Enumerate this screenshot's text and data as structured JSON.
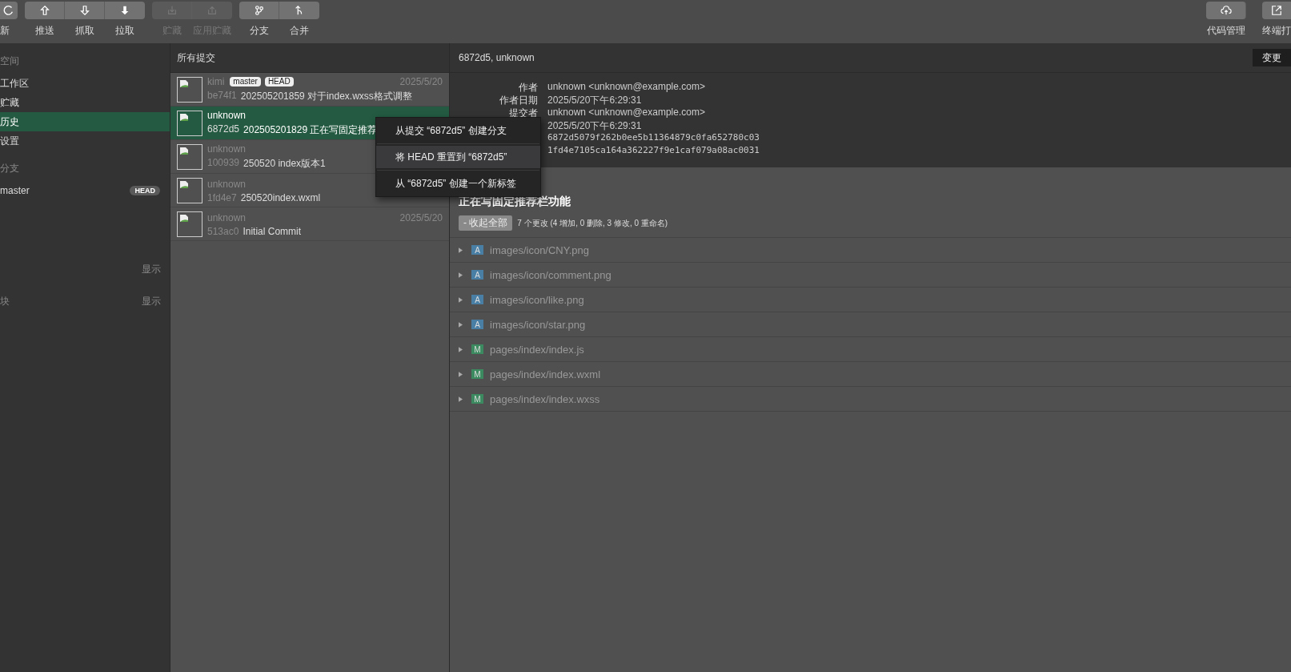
{
  "toolbar": {
    "left_groups": [
      {
        "buttons": [
          {
            "label": "新",
            "disabled": false,
            "cut": true
          }
        ]
      },
      {
        "buttons": [
          {
            "label": "推送",
            "disabled": false
          },
          {
            "label": "抓取",
            "disabled": false
          },
          {
            "label": "拉取",
            "disabled": false
          }
        ]
      },
      {
        "buttons": [
          {
            "label": "贮藏",
            "disabled": true
          },
          {
            "label": "应用贮藏",
            "disabled": true
          }
        ]
      },
      {
        "buttons": [
          {
            "label": "分支",
            "disabled": false
          },
          {
            "label": "合并",
            "disabled": false
          }
        ]
      }
    ],
    "right_buttons": [
      {
        "label": "代码管理",
        "disabled": false
      },
      {
        "label": "终端打",
        "disabled": false,
        "cut": true
      }
    ]
  },
  "sidebar": {
    "sections": [
      {
        "title": "空间",
        "items": [
          {
            "label": "工作区",
            "selected": false
          },
          {
            "label": "贮藏",
            "selected": false
          },
          {
            "label": "历史",
            "selected": true
          },
          {
            "label": "设置",
            "selected": false
          }
        ]
      },
      {
        "title": "分支",
        "items": [
          {
            "label": "master",
            "badge": "HEAD",
            "selected": false
          }
        ]
      }
    ],
    "extra_rows": [
      {
        "action": "显示"
      },
      {
        "label": "块",
        "action": "显示"
      }
    ]
  },
  "commit_list": {
    "title": "所有提交",
    "commits": [
      {
        "author": "kimi",
        "refs": [
          "master",
          "HEAD"
        ],
        "hash": "be74f1",
        "message": "202505201859 对于index.wxss格式调整",
        "date": "2025/5/20",
        "selected": false
      },
      {
        "author": "unknown",
        "hash": "6872d5",
        "message": "202505201829 正在写固定推荐",
        "selected": true
      },
      {
        "author": "unknown",
        "hash": "100939",
        "message": "250520 index版本1",
        "selected": false
      },
      {
        "author": "unknown",
        "hash": "1fd4e7",
        "message": "250520index.wxml",
        "selected": false
      },
      {
        "author": "unknown",
        "hash": "513ac0",
        "message": "Initial Commit",
        "date": "2025/5/20",
        "selected": false
      }
    ]
  },
  "detail": {
    "title": "6872d5, unknown",
    "changes_button": "变更",
    "info": [
      {
        "label": "作者",
        "value": "unknown <unknown@example.com>"
      },
      {
        "label": "作者日期",
        "value": "2025/5/20下午6:29:31"
      },
      {
        "label": "提交者",
        "value": "unknown <unknown@example.com>"
      },
      {
        "value": "2025/5/20下午6:29:31"
      },
      {
        "value": "6872d5079f262b0ee5b11364879c0fa652780c03",
        "kind": "sha"
      },
      {
        "value": "1fd4e7105ca164a362227f9e1caf079a08ac0031",
        "kind": "sha"
      }
    ],
    "subject": "正在写固定推荐栏功能",
    "collapse_button": "- 收起全部",
    "summary": "7 个更改 (4 增加, 0 删除, 3 修改, 0 重命名)",
    "files": [
      {
        "status": "A",
        "path": "images/icon/CNY.png"
      },
      {
        "status": "A",
        "path": "images/icon/comment.png"
      },
      {
        "status": "A",
        "path": "images/icon/like.png"
      },
      {
        "status": "A",
        "path": "images/icon/star.png"
      },
      {
        "status": "M",
        "path": "pages/index/index.js"
      },
      {
        "status": "M",
        "path": "pages/index/index.wxml"
      },
      {
        "status": "M",
        "path": "pages/index/index.wxss"
      }
    ]
  },
  "context_menu": {
    "items": [
      {
        "label": "从提交 “6872d5” 创建分支",
        "selected": false
      },
      {
        "label": "将 HEAD 重置到 “6872d5”",
        "selected": true
      },
      {
        "label": "从 “6872d5” 创建一个新标签",
        "selected": false
      }
    ]
  }
}
